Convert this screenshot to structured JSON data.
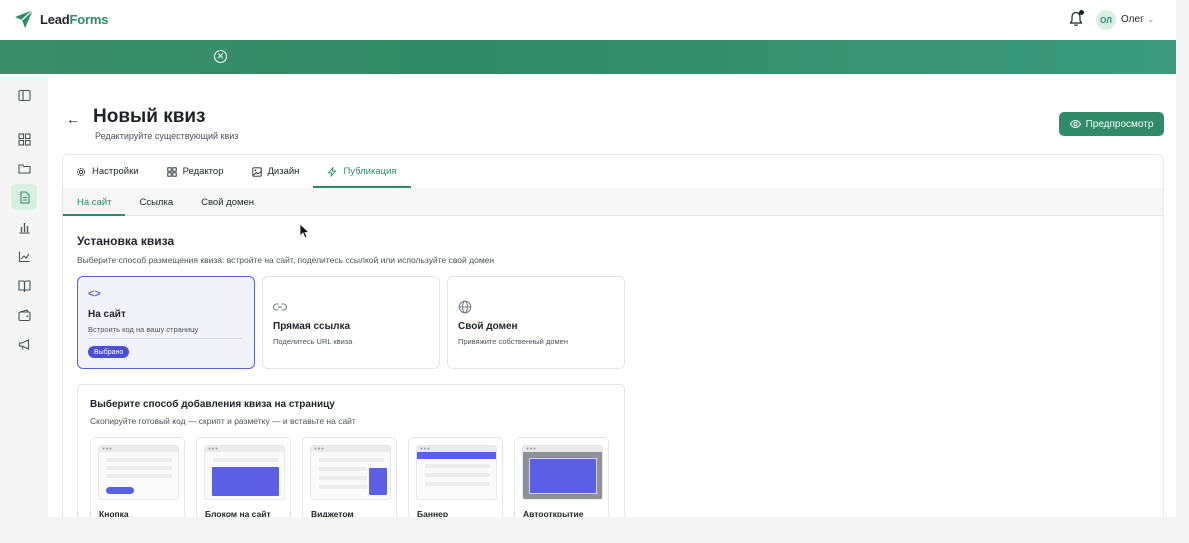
{
  "brand": {
    "logo_part1": "Lead",
    "logo_part2": "Forms",
    "accent": "#2e8b6a",
    "selected": "#5b5fdb"
  },
  "header": {
    "user_initials": "ОЛ",
    "user_name": "Олег",
    "user_chevron": "⌄"
  },
  "banner": {
    "close_icon": "close-circle-icon"
  },
  "sidebar": {
    "items": [
      {
        "icon": "panel-toggle-icon"
      },
      {
        "icon": "dashboard-grid-icon"
      },
      {
        "icon": "folder-icon"
      },
      {
        "icon": "document-icon",
        "active": true
      },
      {
        "icon": "bar-chart-icon"
      },
      {
        "icon": "line-chart-icon"
      },
      {
        "icon": "book-icon"
      },
      {
        "icon": "wallet-icon"
      },
      {
        "icon": "megaphone-icon"
      }
    ]
  },
  "page": {
    "back_glyph": "←",
    "title": "Новый квиз",
    "subtitle": "Редактируйте существующий квиз",
    "preview_button": "Предпросмотр"
  },
  "tabs": [
    {
      "label": "Настройки",
      "icon": "gear-icon"
    },
    {
      "label": "Редактор",
      "icon": "grid-icon"
    },
    {
      "label": "Дизайн",
      "icon": "image-icon"
    },
    {
      "label": "Публикация",
      "icon": "bolt-icon",
      "active": true
    }
  ],
  "subtabs": [
    {
      "label": "На сайт",
      "active": true
    },
    {
      "label": "Ссылка"
    },
    {
      "label": "Свой домен"
    }
  ],
  "install": {
    "title": "Установка квиза",
    "description": "Выберите способ размещения квиза: встройте на сайт, поделитесь ссылкой или используйте свой домен",
    "options": [
      {
        "title": "На сайт",
        "desc": "Встроить код на вашу страницу",
        "icon": "code-icon",
        "glyph": "<>",
        "badge": "Выбрано",
        "selected": true
      },
      {
        "title": "Прямая ссылка",
        "desc": "Поделитесь URL квиза",
        "icon": "link-icon"
      },
      {
        "title": "Свой домен",
        "desc": "Привяжите собственный домен",
        "icon": "globe-icon"
      }
    ]
  },
  "method": {
    "title": "Выберите способ добавления квиза на страницу",
    "description": "Скопируйте готовый код — скрипт и разметку — и вставьте на сайт",
    "cards": [
      {
        "label": "Кнопка"
      },
      {
        "label": "Блоком на сайт"
      },
      {
        "label": "Виджетом"
      },
      {
        "label": "Баннер"
      },
      {
        "label": "Автооткрытие"
      }
    ]
  }
}
